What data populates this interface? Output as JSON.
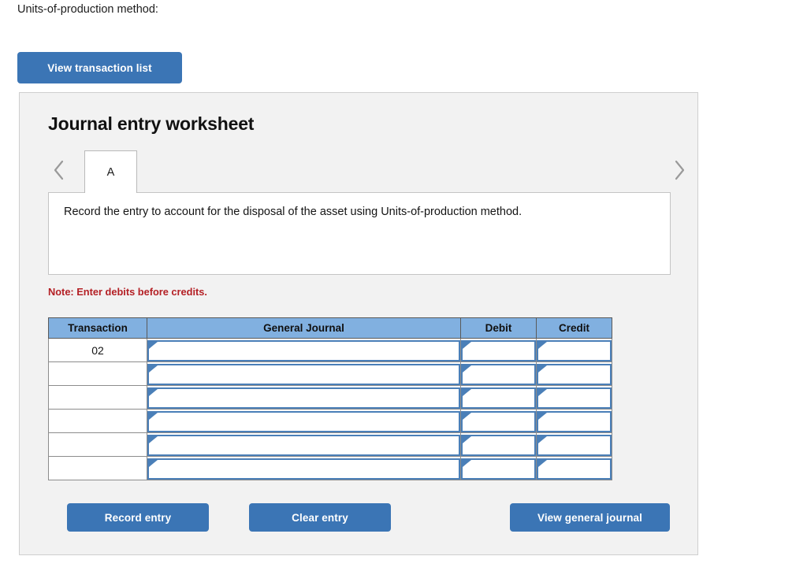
{
  "intro": {
    "text": "Units-of-production method:"
  },
  "toolbar": {
    "view_transaction_list_label": "View transaction list"
  },
  "panel": {
    "title": "Journal entry worksheet",
    "nav": {
      "prev_icon": "chevron-left-icon",
      "next_icon": "chevron-right-icon"
    },
    "tabs": [
      {
        "label": "A",
        "active": true
      }
    ],
    "instruction": "Record the entry to account for the disposal of the asset using Units-of-production method.",
    "note": "Note: Enter debits before credits.",
    "table": {
      "columns": [
        "Transaction",
        "General Journal",
        "Debit",
        "Credit"
      ],
      "rows": [
        {
          "transaction": "02",
          "general_journal": "",
          "debit": "",
          "credit": ""
        },
        {
          "transaction": "",
          "general_journal": "",
          "debit": "",
          "credit": ""
        },
        {
          "transaction": "",
          "general_journal": "",
          "debit": "",
          "credit": ""
        },
        {
          "transaction": "",
          "general_journal": "",
          "debit": "",
          "credit": ""
        },
        {
          "transaction": "",
          "general_journal": "",
          "debit": "",
          "credit": ""
        },
        {
          "transaction": "",
          "general_journal": "",
          "debit": "",
          "credit": ""
        }
      ]
    },
    "actions": {
      "record_label": "Record entry",
      "clear_label": "Clear entry",
      "view_journal_label": "View general journal"
    }
  },
  "colors": {
    "button_blue": "#3b75b5",
    "table_header_blue": "#81b0e0",
    "input_border_blue": "#4a7fb8",
    "note_red": "#b42025",
    "panel_bg": "#f2f2f2"
  }
}
